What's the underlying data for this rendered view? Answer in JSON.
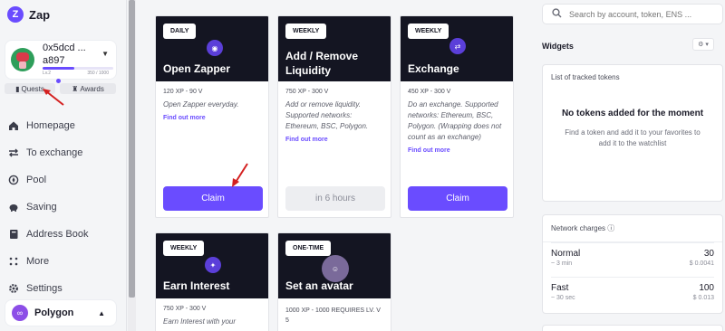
{
  "app": {
    "name": "Zap",
    "logo_glyph": "Z"
  },
  "account": {
    "address_line1": "0x5dcd ...",
    "address_line2": "a897",
    "level": "Lv.2",
    "xp": "350 / 1000",
    "xp_progress": 0.45
  },
  "tabs": {
    "quests": "Quests",
    "awards": "Awards"
  },
  "nav": [
    {
      "label": "Homepage",
      "icon": "home-icon"
    },
    {
      "label": "To exchange",
      "icon": "exchange-icon"
    },
    {
      "label": "Pool",
      "icon": "pool-icon"
    },
    {
      "label": "Saving",
      "icon": "piggy-bank-icon"
    },
    {
      "label": "Address Book",
      "icon": "address-book-icon"
    },
    {
      "label": "More",
      "icon": "grid-icon"
    },
    {
      "label": "Settings",
      "icon": "gear-icon"
    }
  ],
  "network": {
    "label": "Polygon"
  },
  "quests": [
    {
      "badge": "DAILY",
      "title": "Open Zapper",
      "xp": "120 XP - 90 V",
      "desc": "Open Zapper everyday.",
      "more": "Find out more",
      "action": "Claim"
    },
    {
      "badge": "WEEKLY",
      "title": "Add / Remove Liquidity",
      "xp": "750 XP - 300 V",
      "desc": "Add or remove liquidity. Supported networks: Ethereum, BSC, Polygon.",
      "more": "Find out more",
      "action": "in 6 hours"
    },
    {
      "badge": "WEEKLY",
      "title": "Exchange",
      "xp": "450 XP - 300 V",
      "desc": "Do an exchange. Supported networks: Ethereum, BSC, Polygon. (Wrapping does not count as an exchange)",
      "more": "Find out more",
      "action": "Claim"
    },
    {
      "badge": "WEEKLY",
      "title": "Earn Interest",
      "xp": "750 XP - 300 V",
      "desc": "Earn Interest with your"
    },
    {
      "badge": "ONE-TIME",
      "title": "Set an avatar",
      "xp": "1000 XP - 1000 REQUIRES LV. V 5"
    }
  ],
  "search": {
    "placeholder": "Search by account, token, ENS ..."
  },
  "widgets": {
    "title": "Widgets",
    "tracked": {
      "title": "List of tracked tokens",
      "empty_title": "No tokens added for the moment",
      "empty_text": "Find a token and add it to your favorites to add it to the watchlist"
    },
    "charges": {
      "title": "Network charges",
      "rows": [
        {
          "name": "Normal",
          "time": "~ 3 min",
          "value": "30",
          "usd": "$ 0.0041"
        },
        {
          "name": "Fast",
          "time": "~ 30 sec",
          "value": "100",
          "usd": "$ 0.013"
        }
      ]
    }
  },
  "colors": {
    "accent": "#6a4cff",
    "dark_card": "#141522",
    "annotation_arrow": "#d42020"
  }
}
